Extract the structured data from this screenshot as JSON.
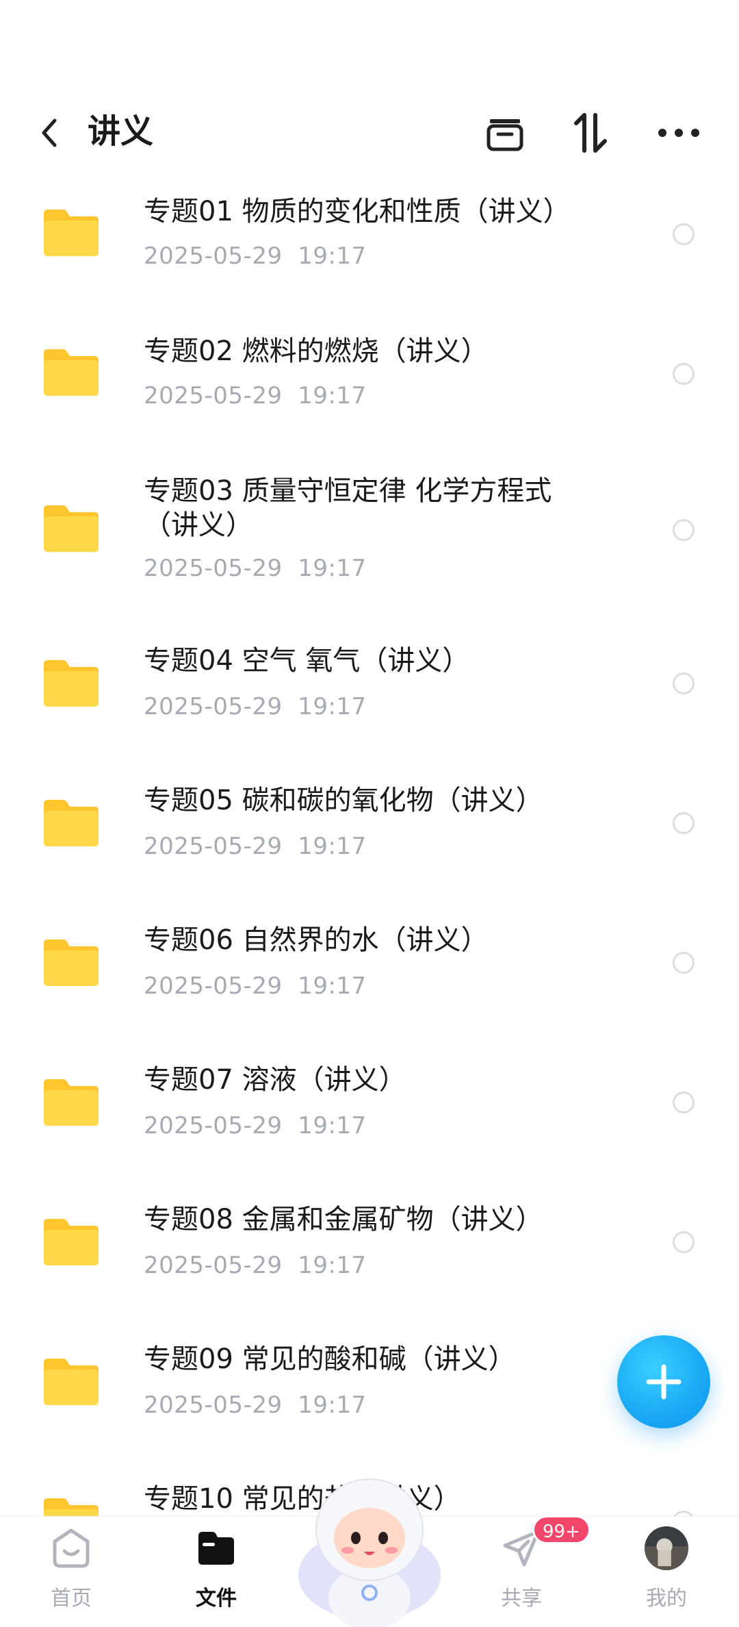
{
  "header": {
    "title": "讲义"
  },
  "files": [
    {
      "title": "专题01 物质的变化和性质（讲义）",
      "date": "2025-05-29  19:17"
    },
    {
      "title": "专题02 燃料的燃烧（讲义）",
      "date": "2025-05-29  19:17"
    },
    {
      "title": "专题03 质量守恒定律  化学方程式（讲义）",
      "date": "2025-05-29  19:17"
    },
    {
      "title": "专题04 空气 氧气（讲义）",
      "date": "2025-05-29  19:17"
    },
    {
      "title": "专题05 碳和碳的氧化物（讲义）",
      "date": "2025-05-29  19:17"
    },
    {
      "title": "专题06 自然界的水（讲义）",
      "date": "2025-05-29  19:17"
    },
    {
      "title": "专题07 溶液（讲义）",
      "date": "2025-05-29  19:17"
    },
    {
      "title": "专题08 金属和金属矿物（讲义）",
      "date": "2025-05-29  19:17"
    },
    {
      "title": "专题09 常见的酸和碱（讲义）",
      "date": "2025-05-29  19:17"
    },
    {
      "title": "专题10 常见的盐（讲义）",
      "date": ""
    }
  ],
  "nav": {
    "home": "首页",
    "files": "文件",
    "share": "共享",
    "mine": "我的",
    "share_badge": "99+"
  },
  "colors": {
    "accent": "#1aa8f5",
    "folder": "#ffcc33",
    "badge": "#f2466a",
    "muted": "#a7a9b3"
  },
  "icons": {
    "back": "chevron-left-icon",
    "archive": "archive-box-icon",
    "sort": "sort-arrows-icon",
    "more": "more-dots-icon",
    "fab": "plus-icon"
  }
}
